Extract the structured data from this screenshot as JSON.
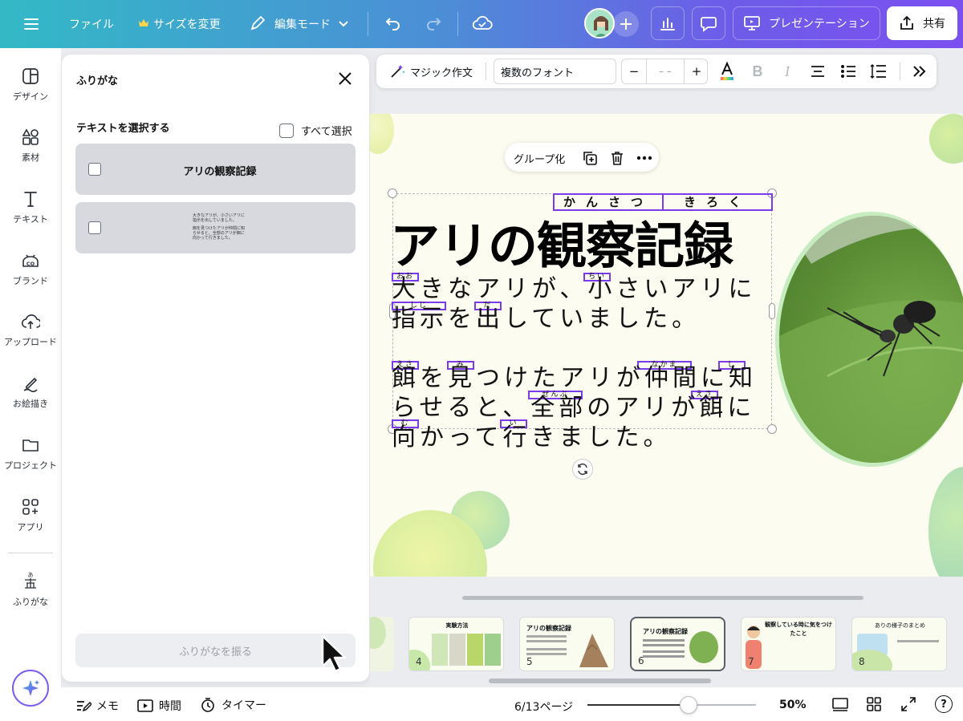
{
  "topbar": {
    "file": "ファイル",
    "resize": "サイズを変更",
    "edit_mode": "編集モード",
    "present": "プレゼンテーション",
    "share": "共有"
  },
  "rail": {
    "items": [
      {
        "label": "デザイン",
        "icon": "layout-icon"
      },
      {
        "label": "素材",
        "icon": "elements-icon"
      },
      {
        "label": "テキスト",
        "icon": "text-icon"
      },
      {
        "label": "ブランド",
        "icon": "brand-icon"
      },
      {
        "label": "アップロード",
        "icon": "upload-icon"
      },
      {
        "label": "お絵描き",
        "icon": "draw-icon"
      },
      {
        "label": "プロジェクト",
        "icon": "folder-icon"
      },
      {
        "label": "アプリ",
        "icon": "apps-icon"
      },
      {
        "label": "ふりがな",
        "icon": "furigana-icon"
      }
    ]
  },
  "panel": {
    "title": "ふりがな",
    "select_text": "テキストを選択する",
    "select_all": "すべて選択",
    "item1_text": "アリの観察記録",
    "item2_lines": [
      "大きなアリが、小さいアリに",
      "指示を出していました。",
      "",
      "餌を見つけたアリが仲間に知",
      "らせると、全部のアリが餌に",
      "向かって行きました。"
    ],
    "apply_button": "ふりがなを振る"
  },
  "format": {
    "magic": "マジック作文",
    "font": "複数のフォント",
    "minus": "−",
    "size": "– –",
    "plus": "+"
  },
  "canvas": {
    "group": "グループ化",
    "title": "アリの観察記録",
    "title_ruby": [
      "かんさつ",
      "きろく"
    ],
    "body_lines": [
      "大きなアリが、小さいアリに",
      "指示を出していました。",
      "",
      "餌を見つけたアリが仲間に知",
      "らせると、全部のアリが餌に",
      "向かって行きました。"
    ],
    "ruby": {
      "oo": "おお",
      "chii": "ちい",
      "shiji": "しじ",
      "da": "だ",
      "esa": "えさ",
      "mi": "み",
      "nakama": "なかま",
      "shi": "し",
      "zenbu": "ぜんぶ",
      "esa2": "えさ",
      "mu": "む",
      "i": "い"
    }
  },
  "filmstrip": {
    "thumbs": [
      {
        "num": "4",
        "title": "実験方法"
      },
      {
        "num": "5",
        "title": "アリの観察記録"
      },
      {
        "num": "6",
        "title": "アリの観察記録"
      },
      {
        "num": "7",
        "title": "観察している時に気をつけたこと"
      },
      {
        "num": "8",
        "title": "ありの様子のまとめ"
      }
    ]
  },
  "bottombar": {
    "memo": "メモ",
    "time": "時間",
    "timer": "タイマー",
    "page": "6/13ページ",
    "zoom": "50%",
    "zoom_fraction": 0.6
  },
  "colors": {
    "accent": "#7c3aed",
    "gradient_start": "#33b9c6",
    "gradient_end": "#7b4ff0"
  }
}
